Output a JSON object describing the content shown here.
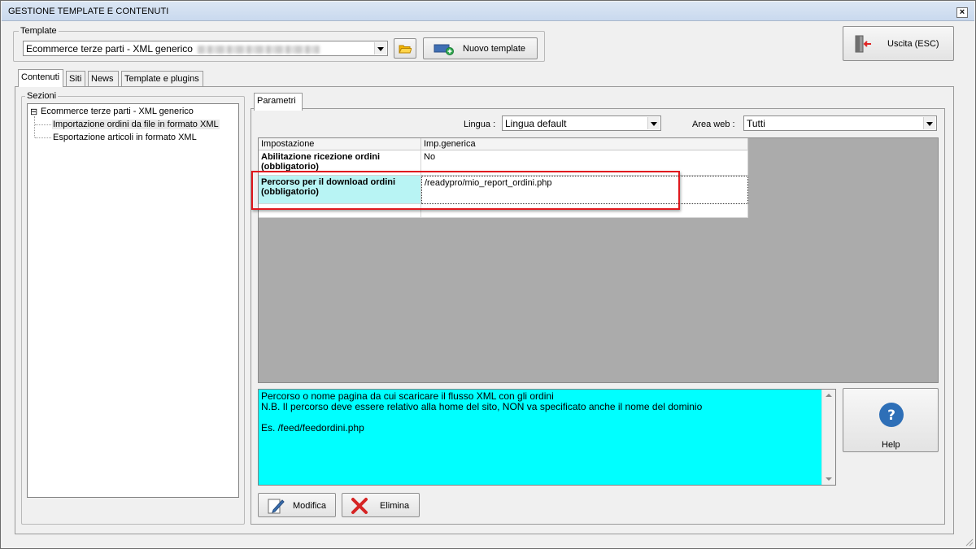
{
  "window": {
    "title": "GESTIONE TEMPLATE E CONTENUTI",
    "close_glyph": "×"
  },
  "template": {
    "group_label": "Template",
    "selected": "Ecommerce terze parti - XML generico",
    "new_template_label": "Nuovo template",
    "exit_label": "Uscita (ESC)"
  },
  "tabs": [
    {
      "label": "Contenuti",
      "active": true
    },
    {
      "label": "Siti"
    },
    {
      "label": "News"
    },
    {
      "label": "Template e plugins"
    }
  ],
  "sections": {
    "group_label": "Sezioni",
    "root": "Ecommerce terze parti - XML generico",
    "expander": "⊟",
    "children": [
      "Importazione ordini da file in formato XML",
      "Esportazione articoli in formato XML"
    ]
  },
  "params_tab": "Parametri",
  "filters": {
    "lingua_label": "Lingua :",
    "lingua_value": "Lingua default",
    "area_label": "Area web :",
    "area_value": "Tutti"
  },
  "grid": {
    "columns": [
      "Impostazione",
      "Imp.generica"
    ],
    "rows": [
      {
        "setting": "Abilitazione ricezione ordini (obbligatorio)",
        "value": "No"
      },
      {
        "setting": "Percorso per il download ordini (obbligatorio)",
        "value": "/readypro/mio_report_ordini.php"
      }
    ]
  },
  "description": {
    "line1": "Percorso o nome pagina da cui scaricare il flusso XML con gli ordini",
    "line2": "N.B. Il percorso deve essere relativo alla home del sito, NON va specificato anche il nome del dominio",
    "line3": "Es. /feed/feedordini.php"
  },
  "help_label": "Help",
  "help_glyph": "?",
  "modify_label": "Modifica",
  "delete_label": "Elimina",
  "colors": {
    "highlight_border": "#e0191e",
    "description_bg": "#00ffff",
    "selected_cell": "#b8f4f4"
  }
}
